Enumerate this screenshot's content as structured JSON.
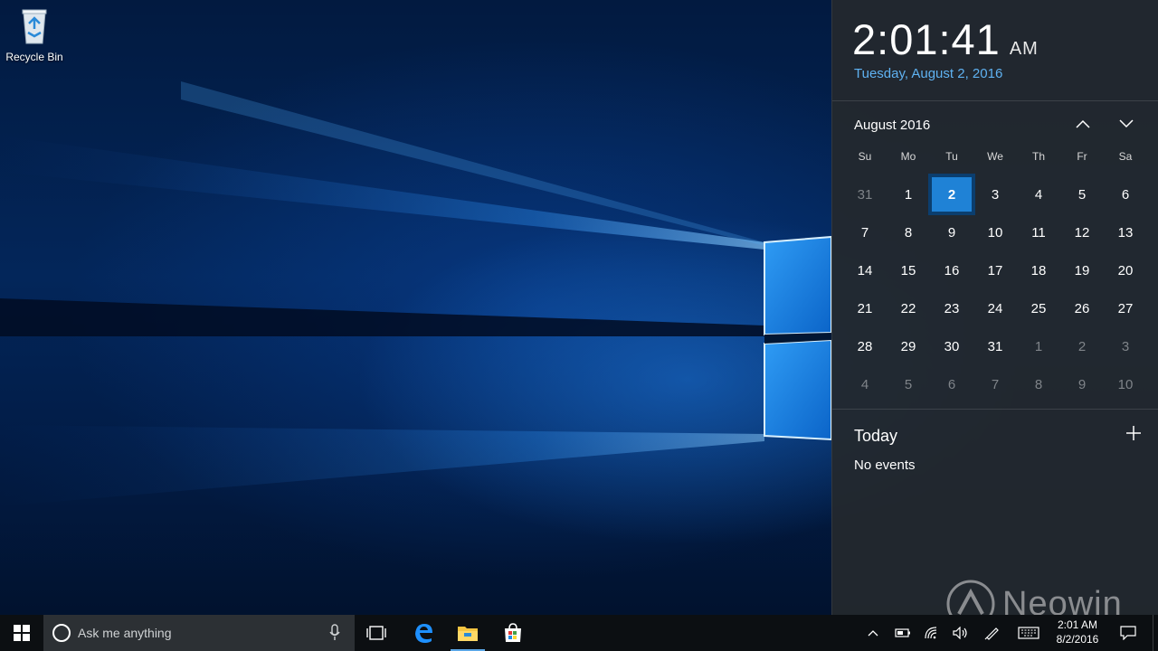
{
  "desktop": {
    "icons": [
      {
        "label": "Recycle Bin",
        "icon": "recycle-bin-icon"
      }
    ]
  },
  "flyout": {
    "time": "2:01:41",
    "ampm": "AM",
    "date_long": "Tuesday, August 2, 2016",
    "month_label": "August 2016",
    "weekdays": [
      "Su",
      "Mo",
      "Tu",
      "We",
      "Th",
      "Fr",
      "Sa"
    ],
    "weeks": [
      [
        "31",
        "1",
        "2",
        "3",
        "4",
        "5",
        "6"
      ],
      [
        "7",
        "8",
        "9",
        "10",
        "11",
        "12",
        "13"
      ],
      [
        "14",
        "15",
        "16",
        "17",
        "18",
        "19",
        "20"
      ],
      [
        "21",
        "22",
        "23",
        "24",
        "25",
        "26",
        "27"
      ],
      [
        "28",
        "29",
        "30",
        "31",
        "1",
        "2",
        "3"
      ],
      [
        "4",
        "5",
        "6",
        "7",
        "8",
        "9",
        "10"
      ]
    ],
    "selected_day": "2",
    "agenda_title": "Today",
    "agenda_empty": "No events",
    "accent_color": "#1f82d6",
    "date_color": "#5fb2f2"
  },
  "watermark": {
    "text": "Neowin"
  },
  "taskbar": {
    "search_placeholder": "Ask me anything",
    "pinned": [
      "edge-icon",
      "file-explorer-icon",
      "store-icon"
    ],
    "tray_time": "2:01 AM",
    "tray_date": "8/2/2016"
  }
}
